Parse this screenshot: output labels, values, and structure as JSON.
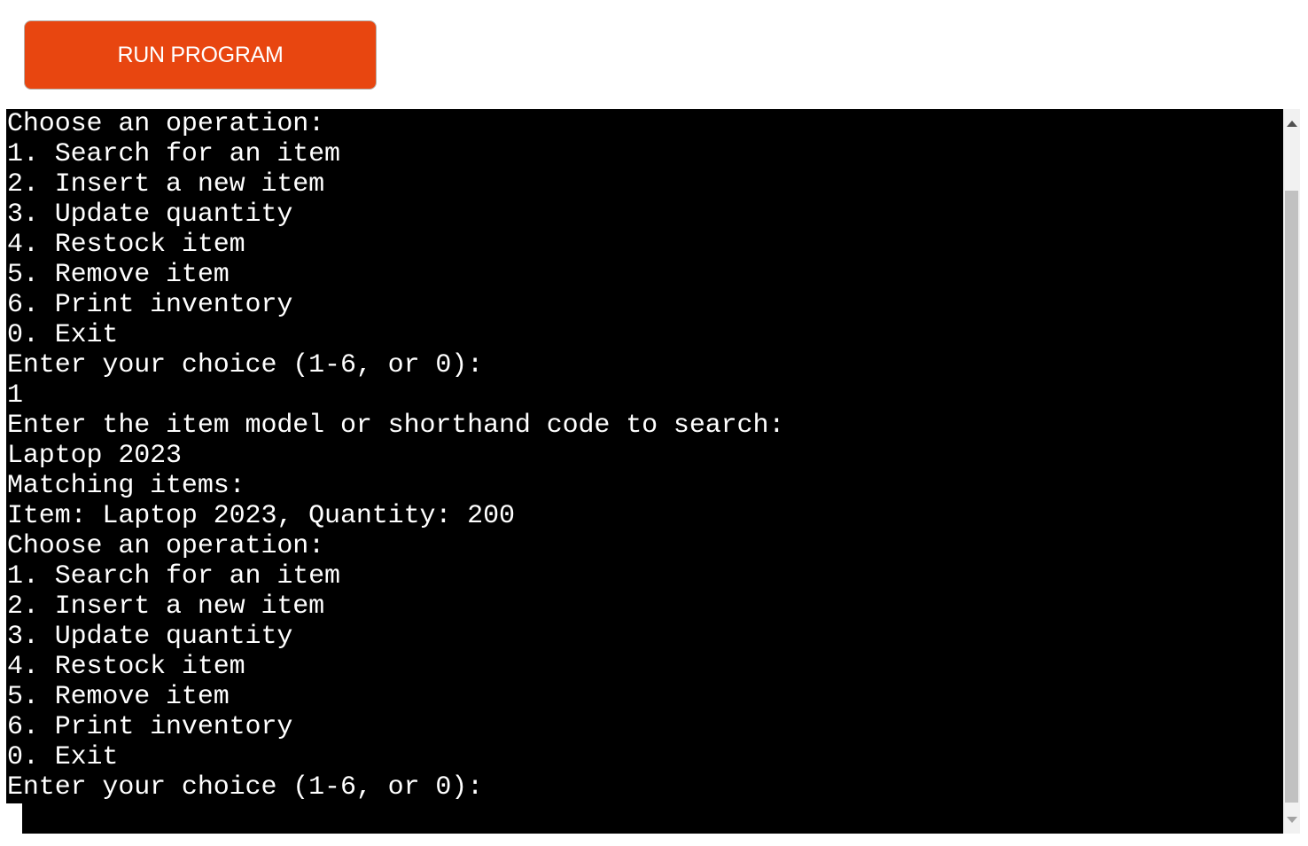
{
  "toolbar": {
    "run_label": "RUN PROGRAM"
  },
  "colors": {
    "run_button": "#e84610",
    "terminal_background": "#000000",
    "terminal_text": "#ffffff"
  },
  "terminal": {
    "lines": [
      "Choose an operation:",
      "1. Search for an item",
      "2. Insert a new item",
      "3. Update quantity",
      "4. Restock item",
      "5. Remove item",
      "6. Print inventory",
      "0. Exit",
      "Enter your choice (1-6, or 0):",
      "1",
      "Enter the item model or shorthand code to search:",
      "Laptop 2023",
      "Matching items:",
      "Item: Laptop 2023, Quantity: 200",
      "Choose an operation:",
      "1. Search for an item",
      "2. Insert a new item",
      "3. Update quantity",
      "4. Restock item",
      "5. Remove item",
      "6. Print inventory",
      "0. Exit",
      "Enter your choice (1-6, or 0):"
    ]
  },
  "scrollbar": {
    "icons": [
      "scroll-up-arrow-icon",
      "scroll-down-arrow-icon"
    ]
  }
}
